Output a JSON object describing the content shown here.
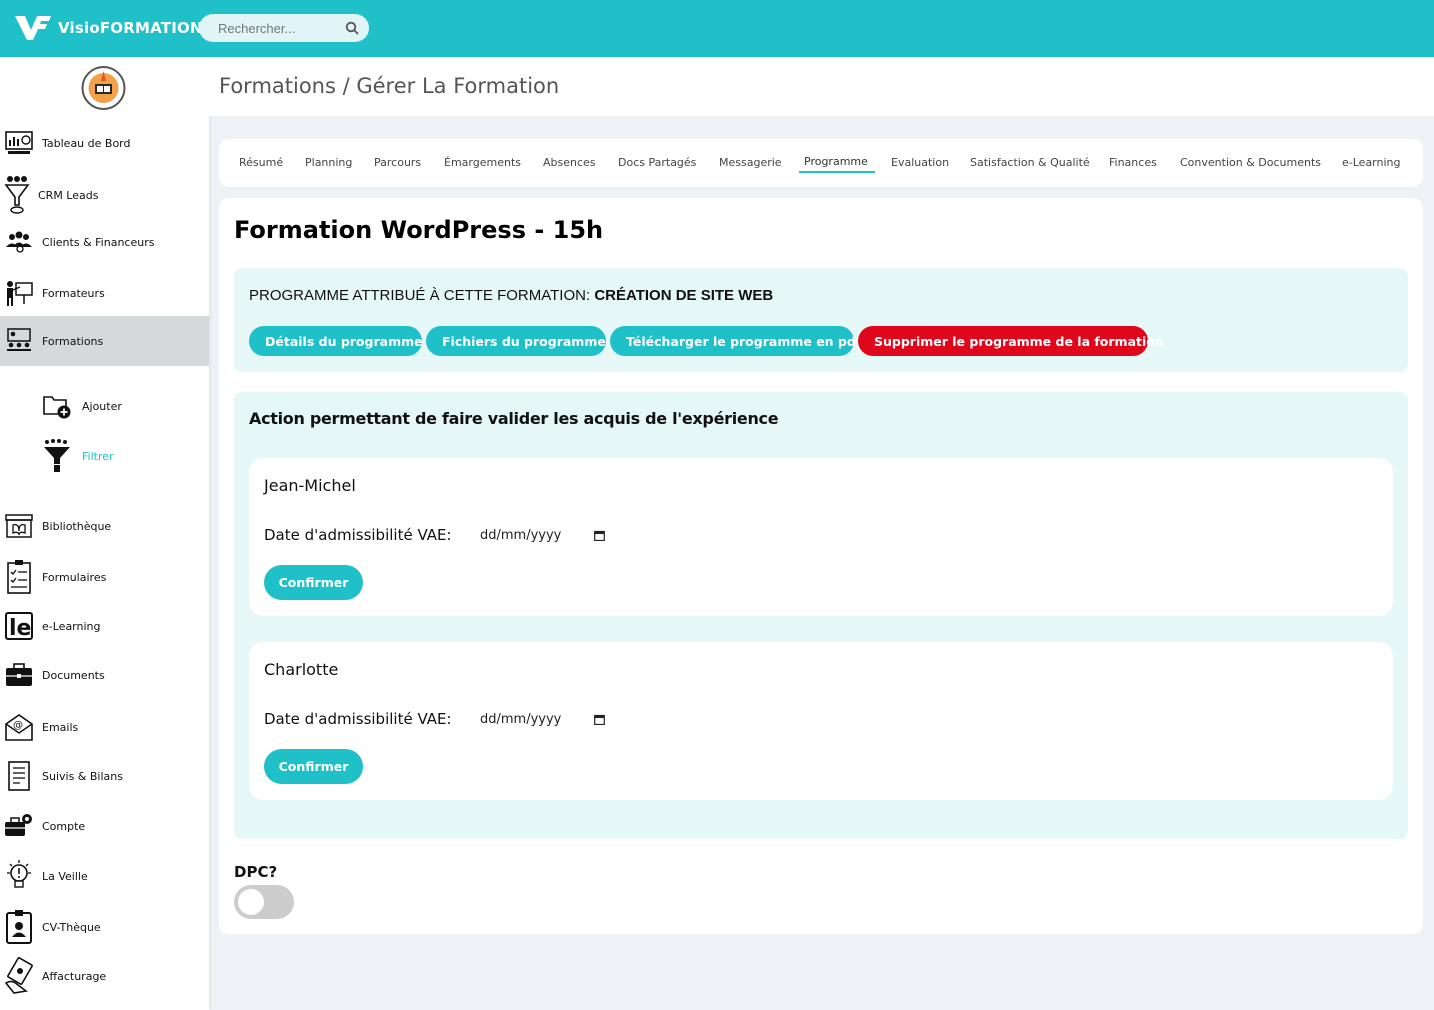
{
  "app": {
    "brand_name": "VisioFORMATION",
    "accent_color": "#20c0c8",
    "danger_color": "#e0061b"
  },
  "search": {
    "placeholder": "Rechercher..."
  },
  "sidebar": {
    "items": [
      {
        "label": "Tableau de Bord",
        "icon": "dashboard-icon"
      },
      {
        "label": "CRM Leads",
        "icon": "funnel-person-icon"
      },
      {
        "label": "Clients & Financeurs",
        "icon": "people-group-icon"
      },
      {
        "label": "Formateurs",
        "icon": "teacher-board-icon"
      },
      {
        "label": "Formations",
        "icon": "classroom-icon",
        "active": true
      },
      {
        "label": "Bibliothèque",
        "icon": "library-icon"
      },
      {
        "label": "Formulaires",
        "icon": "checklist-icon"
      },
      {
        "label": "e-Learning",
        "icon": "elearning-icon"
      },
      {
        "label": "Documents",
        "icon": "briefcase-icon"
      },
      {
        "label": "Emails",
        "icon": "email-icon"
      },
      {
        "label": "Suivis & Bilans",
        "icon": "report-icon"
      },
      {
        "label": "Compte",
        "icon": "account-gear-icon"
      },
      {
        "label": "La Veille",
        "icon": "lightbulb-icon"
      },
      {
        "label": "CV-Thèque",
        "icon": "id-badge-icon"
      },
      {
        "label": "Affacturage",
        "icon": "hand-money-icon"
      }
    ],
    "sub_items": [
      {
        "label": "Ajouter",
        "icon": "folder-add-icon"
      },
      {
        "label": "Filtrer",
        "icon": "filter-icon",
        "active": true
      }
    ]
  },
  "header": {
    "breadcrumb": "Formations / Gérer La Formation"
  },
  "tabs": [
    {
      "label": "Résumé"
    },
    {
      "label": "Planning"
    },
    {
      "label": "Parcours"
    },
    {
      "label": "Émargements"
    },
    {
      "label": "Absences"
    },
    {
      "label": "Docs Partagés"
    },
    {
      "label": "Messagerie"
    },
    {
      "label": "Programme",
      "active": true
    },
    {
      "label": "Evaluation"
    },
    {
      "label": "Satisfaction & Qualité"
    },
    {
      "label": "Finances"
    },
    {
      "label": "Convention & Documents"
    },
    {
      "label": "e-Learning"
    }
  ],
  "formation": {
    "title": "Formation WordPress - 15h",
    "programme_prefix": "PROGRAMME ATTRIBUÉ À CETTE FORMATION:",
    "programme_name": "CRÉATION DE SITE WEB",
    "buttons": {
      "details": "Détails du programme",
      "files": "Fichiers du programme",
      "download_pdf": "Télécharger le programme en pdf",
      "remove": "Supprimer le programme de la formation"
    }
  },
  "vae": {
    "title": "Action permettant de faire valider les acquis de l'expérience",
    "people": [
      {
        "name": "Jean-Michel",
        "date_label": "Date d'admissibilité VAE:",
        "date_value": "dd/mm/yyyy",
        "confirm_label": "Confirmer"
      },
      {
        "name": "Charlotte",
        "date_label": "Date d'admissibilité VAE:",
        "date_value": "dd/mm/yyyy",
        "confirm_label": "Confirmer"
      }
    ]
  },
  "dpc": {
    "label": "DPC?",
    "enabled": false
  }
}
